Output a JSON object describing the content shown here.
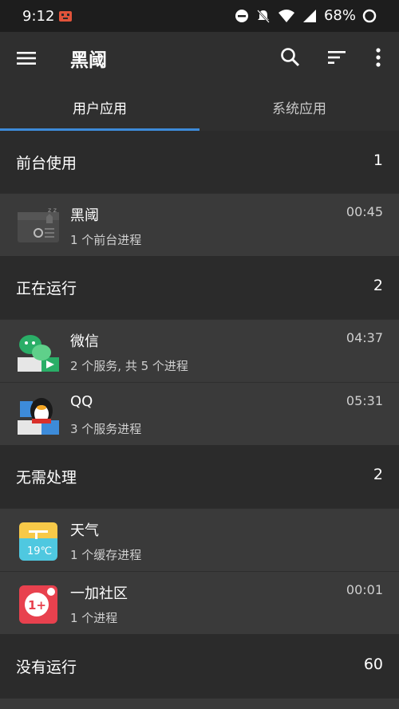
{
  "status_bar": {
    "time": "9:12",
    "battery": "68%"
  },
  "app_bar": {
    "title": "黑阈"
  },
  "tabs": [
    {
      "label": "用户应用",
      "active": true
    },
    {
      "label": "系统应用",
      "active": false
    }
  ],
  "sections": [
    {
      "title": "前台使用",
      "count": "1",
      "apps": [
        {
          "name": "黑阈",
          "detail": "1 个前台进程",
          "time": "00:45",
          "icon": "heiyu-app-icon"
        }
      ]
    },
    {
      "title": "正在运行",
      "count": "2",
      "apps": [
        {
          "name": "微信",
          "detail": "2 个服务, 共 5 个进程",
          "time": "04:37",
          "icon": "wechat-app-icon"
        },
        {
          "name": "QQ",
          "detail": "3 个服务进程",
          "time": "05:31",
          "icon": "qq-app-icon"
        }
      ]
    },
    {
      "title": "无需处理",
      "count": "2",
      "apps": [
        {
          "name": "天气",
          "detail": "1 个缓存进程",
          "time": "",
          "icon": "weather-app-icon",
          "icon_text": "19℃"
        },
        {
          "name": "一加社区",
          "detail": "1 个进程",
          "time": "00:01",
          "icon": "oneplus-community-app-icon",
          "icon_text": "1+"
        }
      ]
    },
    {
      "title": "没有运行",
      "count": "60",
      "apps": []
    }
  ],
  "colors": {
    "accent": "#3d8bd9",
    "background": "#2b2b2b",
    "row": "#3a3a3a",
    "appbar": "#2f2f2f"
  }
}
